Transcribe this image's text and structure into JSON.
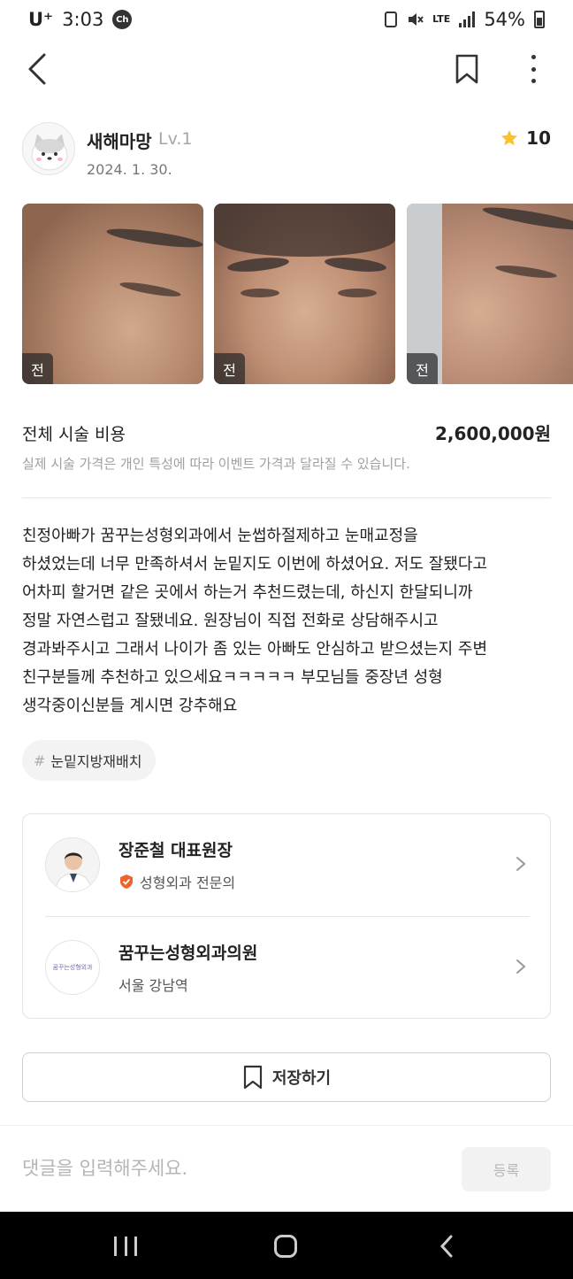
{
  "status_bar": {
    "carrier": "U⁺",
    "time": "3:03",
    "chat_badge": "Ch",
    "network": "LTE",
    "battery": "54%"
  },
  "nav": {
    "back_icon": "chevron-left-icon",
    "bookmark_icon": "bookmark-icon",
    "more_icon": "more-vertical-icon"
  },
  "author": {
    "name": "새해마망",
    "level": "Lv.1",
    "date": "2024. 1. 30.",
    "rating": "10"
  },
  "photos": [
    {
      "tag": "전"
    },
    {
      "tag": "전"
    },
    {
      "tag": "전"
    }
  ],
  "cost": {
    "label": "전체 시술 비용",
    "value": "2,600,000원",
    "note": "실제 시술 가격은 개인 특성에 따라 이벤트 가격과 달라질 수 있습니다."
  },
  "review_lines": [
    "친정아빠가 꿈꾸는성형외과에서 눈썹하절제하고 눈매교정을",
    "하셨었는데 너무 만족하셔서 눈밑지도 이번에 하셨어요. 저도 잘됐다고",
    "어차피 할거면 같은 곳에서 하는거 추천드렸는데, 하신지 한달되니까",
    "정말 자연스럽고 잘됐네요. 원장님이 직접 전화로 상담해주시고",
    "경과봐주시고 그래서 나이가 좀 있는 아빠도 안심하고 받으셨는지 주변",
    "친구분들께 추천하고 있으세요ㅋㅋㅋㅋㅋ 부모님들 중장년 성형",
    "생각중이신분들 계시면 강추해요"
  ],
  "hashtag": {
    "symbol": "#",
    "text": "눈밑지방재배치"
  },
  "doctor": {
    "name": "장준철 대표원장",
    "specialty": "성형외과 전문의",
    "badge_color": "#f0642b"
  },
  "clinic": {
    "name": "꿈꾸는성형외과의원",
    "location": "서울 강남역",
    "logo_text": "꿈꾸는성형외과"
  },
  "save_button": "저장하기",
  "comment": {
    "placeholder": "댓글을 입력해주세요.",
    "submit": "등록"
  },
  "colors": {
    "star": "#f8c32c",
    "badge": "#f0642b"
  }
}
